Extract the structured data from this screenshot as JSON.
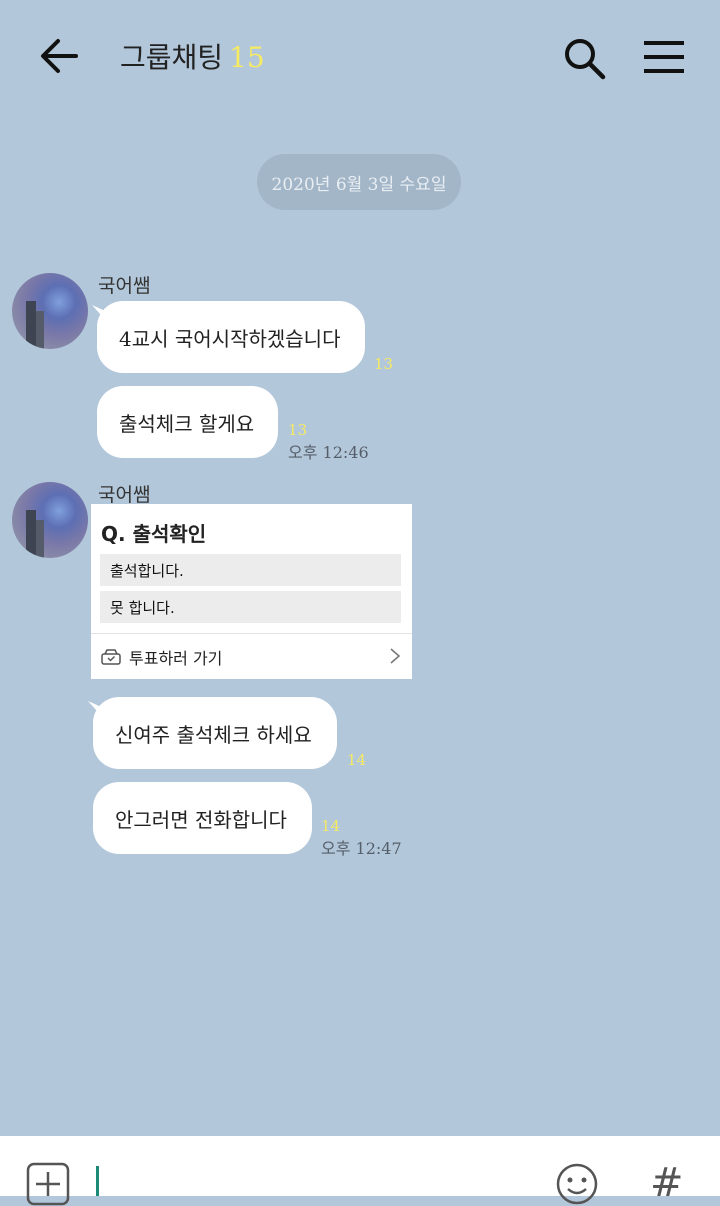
{
  "header": {
    "title": "그룹채팅",
    "member_count": "15"
  },
  "date_divider": "2020년 6월 3일 수요일",
  "messages": [
    {
      "sender": "국어쌤",
      "text": "4교시 국어시작하겠습니다",
      "unread": "13"
    },
    {
      "text": "출석체크 할게요",
      "unread": "13",
      "time": "오후 12:46"
    },
    {
      "sender": "국어쌤"
    },
    {
      "text": "신여주 출석체크 하세요",
      "unread": "14"
    },
    {
      "text": "안그러면 전화합니다",
      "unread": "14",
      "time": "오후 12:47"
    }
  ],
  "poll": {
    "question": "Q. 출석확인",
    "options": [
      "출석합니다.",
      "못 합니다."
    ],
    "action_label": "투표하러 가기"
  },
  "icons": {
    "back": "arrow-left-icon",
    "search": "search-icon",
    "menu": "hamburger-menu-icon",
    "attach": "plus-square-icon",
    "emoji": "smiley-icon",
    "hashtag": "hash-icon"
  },
  "colors": {
    "background": "#b2c7da",
    "unread": "#f6ea63",
    "cursor": "#1b8a76"
  }
}
